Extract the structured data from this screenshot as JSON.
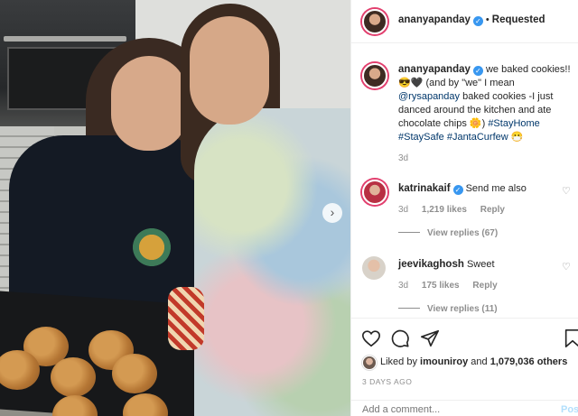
{
  "header": {
    "username": "ananyapanday",
    "dot": "•",
    "follow_status": "Requested"
  },
  "caption": {
    "username": "ananyapanday",
    "text_1": "we baked cookies!!",
    "text_2": "😎🖤 (and by \"we\" I mean",
    "mention": "@rysapanday",
    "text_3": "baked cookies -I just danced around the kitchen and ate chocolate chips 🌼)",
    "hashtag_1": "#StayHome",
    "hashtag_2": "#StaySafe",
    "hashtag_3": "#JantaCurfew",
    "emoji_end": "😷",
    "time": "3d"
  },
  "comments": [
    {
      "username": "katrinakaif",
      "verified": true,
      "text": "Send me also",
      "time": "3d",
      "likes": "1,219 likes",
      "reply": "Reply",
      "view_replies": "View replies (67)"
    },
    {
      "username": "jeevikaghosh",
      "verified": false,
      "text": "Sweet",
      "time": "3d",
      "likes": "175 likes",
      "reply": "Reply",
      "view_replies": "View replies (11)"
    }
  ],
  "actions": {
    "icons": [
      "heart-icon",
      "comment-icon",
      "share-icon",
      "save-icon"
    ]
  },
  "likes": {
    "prefix": "Liked by",
    "user": "imouniroy",
    "middle": "and",
    "count": "1,079,036 others"
  },
  "posted": "3 DAYS AGO",
  "add_comment": {
    "placeholder": "Add a comment...",
    "post_label": "Post"
  },
  "colors": {
    "verified": "#3897f0",
    "link": "#00376b",
    "muted": "#8e8e8e",
    "story_ring": "#e23f6e"
  }
}
